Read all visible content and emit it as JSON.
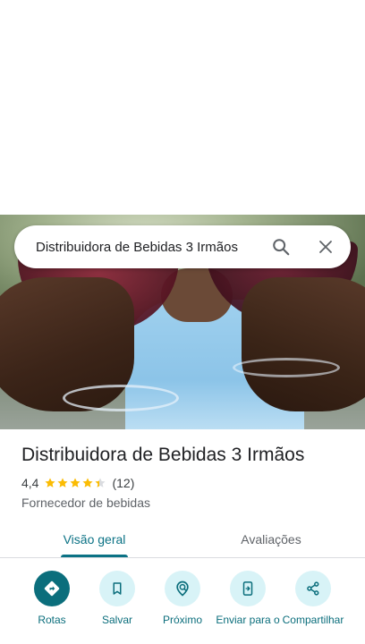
{
  "search": {
    "query": "Distribuidora de Bebidas 3 Irmãos"
  },
  "place": {
    "name": "Distribuidora de Bebidas 3 Irmãos",
    "rating": "4,4",
    "stars": 4.4,
    "reviews": "(12)",
    "category": "Fornecedor de bebidas"
  },
  "tabs": [
    {
      "label": "Visão geral",
      "active": true
    },
    {
      "label": "Avaliações",
      "active": false
    }
  ],
  "actions": [
    {
      "label": "Rotas",
      "icon": "directions-icon"
    },
    {
      "label": "Salvar",
      "icon": "bookmark-icon"
    },
    {
      "label": "Próximo",
      "icon": "nearby-icon"
    },
    {
      "label": "Enviar para o",
      "icon": "send-to-phone-icon"
    },
    {
      "label": "Compartilhar",
      "icon": "share-icon"
    }
  ],
  "colors": {
    "accent": "#0b6e7c",
    "accent_light": "#d8f3f7",
    "star": "#fbbc04"
  }
}
